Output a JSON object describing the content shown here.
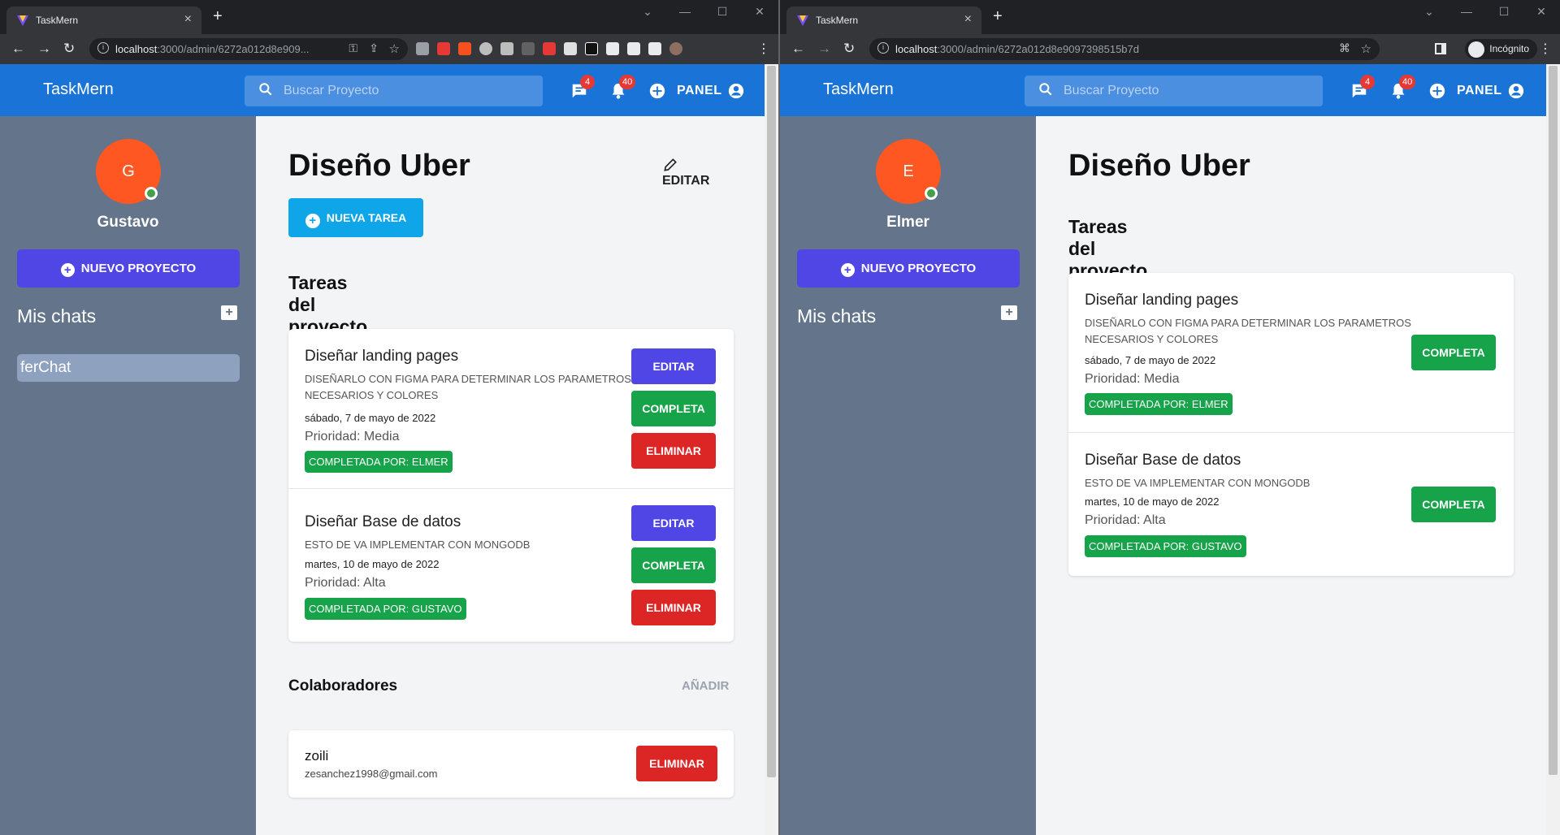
{
  "windows": [
    {
      "tab_title": "TaskMern",
      "url_host": "localhost",
      "url_path": ":3000/admin/6272a012d8e909...",
      "header": {
        "brand": "TaskMern",
        "search_placeholder": "Buscar Proyecto",
        "messages_badge": "4",
        "notifications_badge": "40",
        "panel_label": "PANEL"
      },
      "sidebar": {
        "avatar_letter": "G",
        "username": "Gustavo",
        "new_project_label": "NUEVO PROYECTO",
        "chats_title": "Mis chats",
        "chats": [
          "ferChat"
        ]
      },
      "project": {
        "title": "Diseño Uber",
        "edit_label": "EDITAR",
        "new_task_label": "NUEVA TAREA",
        "tasks_title": "Tareas del proyecto",
        "tasks": [
          {
            "name": "Diseñar landing pages",
            "description_1": "DISEÑARLO CON FIGMA PARA DETERMINAR LOS PARAMETROS",
            "description_2": "NECESARIOS Y COLORES",
            "date": "sábado, 7 de mayo de 2022",
            "priority": "Prioridad: Media",
            "completed_by": "COMPLETADA POR: ELMER",
            "edit_label": "EDITAR",
            "complete_label": "COMPLETA",
            "delete_label": "ELIMINAR"
          },
          {
            "name": "Diseñar Base de datos",
            "description_1": "ESTO DE VA IMPLEMENTAR CON MONGODB",
            "date": "martes, 10 de mayo de 2022",
            "priority": "Prioridad: Alta",
            "completed_by": "COMPLETADA POR: GUSTAVO",
            "edit_label": "EDITAR",
            "complete_label": "COMPLETA",
            "delete_label": "ELIMINAR"
          }
        ],
        "collaborators_title": "Colaboradores",
        "add_label": "AÑADIR",
        "collaborators": [
          {
            "name": "zoili",
            "email": "zesanchez1998@gmail.com",
            "delete_label": "ELIMINAR"
          }
        ]
      }
    },
    {
      "tab_title": "TaskMern",
      "url_host": "localhost",
      "url_path": ":3000/admin/6272a012d8e9097398515b7d",
      "incognito_label": "Incógnito",
      "header": {
        "brand": "TaskMern",
        "search_placeholder": "Buscar Proyecto",
        "messages_badge": "4",
        "notifications_badge": "40",
        "panel_label": "PANEL"
      },
      "sidebar": {
        "avatar_letter": "E",
        "username": "Elmer",
        "new_project_label": "NUEVO PROYECTO",
        "chats_title": "Mis chats"
      },
      "project": {
        "title": "Diseño Uber",
        "tasks_title": "Tareas del proyecto",
        "tasks": [
          {
            "name": "Diseñar landing pages",
            "description_1": "DISEÑARLO CON FIGMA PARA DETERMINAR LOS PARAMETROS",
            "description_2": "NECESARIOS Y COLORES",
            "date": "sábado, 7 de mayo de 2022",
            "priority": "Prioridad: Media",
            "completed_by": "COMPLETADA POR: ELMER",
            "complete_label": "COMPLETA"
          },
          {
            "name": "Diseñar Base de datos",
            "description_1": "ESTO DE VA IMPLEMENTAR CON MONGODB",
            "date": "martes, 10 de mayo de 2022",
            "priority": "Prioridad: Alta",
            "completed_by": "COMPLETADA POR: GUSTAVO",
            "complete_label": "COMPLETA"
          }
        ]
      }
    }
  ],
  "colors": {
    "header": "#1a73d6",
    "sidebar": "#64748b",
    "primary": "#4f46e5",
    "success": "#16a34a",
    "danger": "#dc2626",
    "sky": "#0ea5e9",
    "avatar": "#ff5722"
  },
  "icons": [
    "search-icon",
    "chat-icon",
    "bell-icon",
    "plus-circle-icon",
    "user-circle-icon",
    "pencil-icon",
    "add-chat-icon"
  ]
}
